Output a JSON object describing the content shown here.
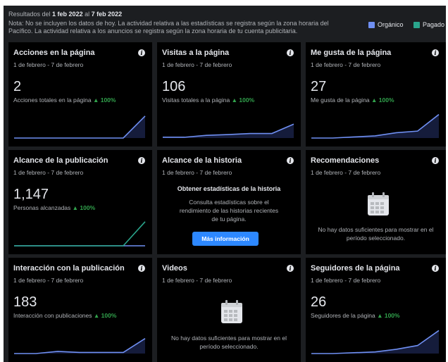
{
  "header": {
    "results_prefix": "Resultados del ",
    "date_from": "1 feb 2022",
    "results_mid": " al ",
    "date_to": "7 feb 2022",
    "note_line1": "Nota: No se incluyen los datos de hoy. La actividad relativa a las estadísticas se registra según la zona horaria del",
    "note_line2": "Pacífico. La actividad relativa a los anuncios se registra según la zona horaria de tu cuenta publicitaria."
  },
  "legend": [
    {
      "label": "Orgánico",
      "color": "#6f8ff2"
    },
    {
      "label": "Pagado",
      "color": "#2aa58c"
    }
  ],
  "cards": {
    "actions": {
      "title": "Acciones en la página",
      "date": "1 de febrero - 7 de febrero",
      "value": "2",
      "caption": "Acciones totales en la página",
      "change": "▲ 100%",
      "spark": [
        0,
        0,
        0,
        0,
        0,
        0,
        0.82
      ]
    },
    "visits": {
      "title": "Visitas a la página",
      "date": "1 de febrero - 7 de febrero",
      "value": "106",
      "caption": "Visitas totales a la página",
      "change": "▲ 100%",
      "spark": [
        0.03,
        0.03,
        0.1,
        0.13,
        0.17,
        0.17,
        0.52
      ]
    },
    "likes": {
      "title": "Me gusta de la página",
      "date": "1 de febrero - 7 de febrero",
      "value": "27",
      "caption": "Me gusta de la página",
      "change": "▲ 100%",
      "spark": [
        0,
        0,
        0.04,
        0.08,
        0.2,
        0.26,
        0.88
      ]
    },
    "reach": {
      "title": "Alcance de la publicación",
      "date": "1 de febrero - 7 de febrero",
      "value": "1,147",
      "caption": "Personas alcanzadas",
      "change": "▲ 100%",
      "spark_paid": [
        0,
        0,
        0,
        0,
        0,
        0,
        0.9
      ]
    },
    "story": {
      "title": "Alcance de la historia",
      "date": "1 de febrero - 7 de febrero",
      "promo_title": "Obtener estadísticas de la historia",
      "promo_desc": "Consulta estadísticas sobre el rendimiento de las historias recientes de tu página.",
      "button": "Más información"
    },
    "recommendations": {
      "title": "Recomendaciones",
      "date": "1 de febrero - 7 de febrero",
      "empty": "No hay datos suficientes para mostrar en el período seleccionado.",
      "icon": "calendar-icon"
    },
    "engagement": {
      "title": "Interacción con la publicación",
      "date": "1 de febrero - 7 de febrero",
      "value": "183",
      "caption": "Interacción con publicaciones",
      "change": "▲ 100%",
      "spark": [
        0,
        0,
        0.08,
        0.04,
        0.04,
        0.04,
        0.56
      ]
    },
    "videos": {
      "title": "Videos",
      "date": "1 de febrero - 7 de febrero",
      "empty": "No hay datos suficientes para mostrar en el período seleccionado.",
      "icon": "calendar-icon"
    },
    "followers": {
      "title": "Seguidores de la página",
      "date": "1 de febrero - 7 de febrero",
      "value": "26",
      "caption": "Seguidores de la página",
      "change": "▲ 100%",
      "spark": [
        0,
        0,
        0.03,
        0.06,
        0.16,
        0.3,
        0.86
      ]
    }
  }
}
